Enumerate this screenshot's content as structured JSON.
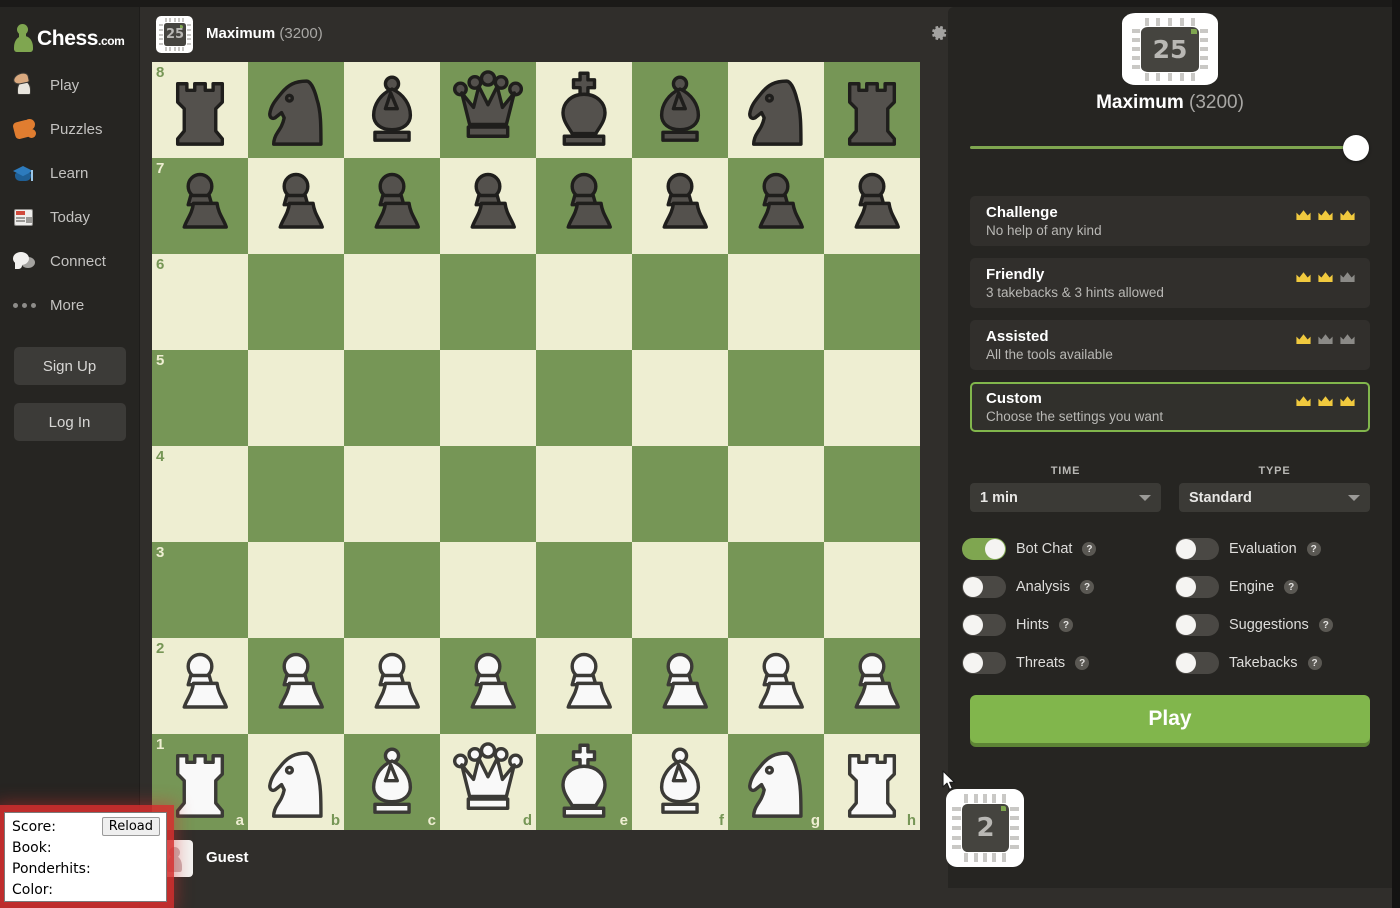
{
  "app": {
    "brand": "Chess",
    "brand_domain": ".com"
  },
  "sidebar": {
    "items": [
      {
        "label": "Play",
        "icon": "play-pawn-icon"
      },
      {
        "label": "Puzzles",
        "icon": "puzzle-piece-icon"
      },
      {
        "label": "Learn",
        "icon": "graduation-cap-icon"
      },
      {
        "label": "Today",
        "icon": "newspaper-icon"
      },
      {
        "label": "Connect",
        "icon": "speech-bubbles-icon"
      },
      {
        "label": "More",
        "icon": "ellipsis-icon"
      }
    ],
    "signup_label": "Sign Up",
    "login_label": "Log In"
  },
  "board_header": {
    "bot_name": "Maximum",
    "bot_rating": "(3200)",
    "avatar_chip_number": "25",
    "settings_icon": "gear-icon"
  },
  "board_footer": {
    "player_name": "Guest",
    "avatar": "pawn-avatar"
  },
  "board": {
    "ranks": [
      "8",
      "7",
      "6",
      "5",
      "4",
      "3",
      "2",
      "1"
    ],
    "files": [
      "a",
      "b",
      "c",
      "d",
      "e",
      "f",
      "g",
      "h"
    ],
    "light_color": "#eeeed2",
    "dark_color": "#769656",
    "position": [
      [
        "br",
        "bn",
        "bb",
        "bq",
        "bk",
        "bb",
        "bn",
        "br"
      ],
      [
        "bp",
        "bp",
        "bp",
        "bp",
        "bp",
        "bp",
        "bp",
        "bp"
      ],
      [
        "",
        "",
        "",
        "",
        "",
        "",
        "",
        ""
      ],
      [
        "",
        "",
        "",
        "",
        "",
        "",
        "",
        ""
      ],
      [
        "",
        "",
        "",
        "",
        "",
        "",
        "",
        ""
      ],
      [
        "",
        "",
        "",
        "",
        "",
        "",
        "",
        ""
      ],
      [
        "wp",
        "wp",
        "wp",
        "wp",
        "wp",
        "wp",
        "wp",
        "wp"
      ],
      [
        "wr",
        "wn",
        "wb",
        "wq",
        "wk",
        "wb",
        "wn",
        "wr"
      ]
    ]
  },
  "panel": {
    "bot_name": "Maximum",
    "bot_rating": "(3200)",
    "avatar_chip_number": "25",
    "strength_slider": {
      "value": 100,
      "accent": "#7fa650"
    },
    "modes": [
      {
        "title": "Challenge",
        "subtitle": "No help of any kind",
        "crowns_filled": 3,
        "selected": false
      },
      {
        "title": "Friendly",
        "subtitle": "3 takebacks & 3 hints allowed",
        "crowns_filled": 2,
        "selected": false
      },
      {
        "title": "Assisted",
        "subtitle": "All the tools available",
        "crowns_filled": 1,
        "selected": false
      },
      {
        "title": "Custom",
        "subtitle": "Choose the settings you want",
        "crowns_filled": 3,
        "selected": true
      }
    ],
    "crown_colors": {
      "filled": "#f0c93e",
      "empty": "#8b8a87"
    },
    "selects": [
      {
        "caption": "TIME",
        "value": "1 min"
      },
      {
        "caption": "TYPE",
        "value": "Standard"
      }
    ],
    "toggles": [
      {
        "label": "Bot Chat",
        "on": true,
        "help": "?"
      },
      {
        "label": "Evaluation",
        "on": false,
        "help": "?"
      },
      {
        "label": "Analysis",
        "on": false,
        "help": "?"
      },
      {
        "label": "Engine",
        "on": false,
        "help": "?"
      },
      {
        "label": "Hints",
        "on": false,
        "help": "?"
      },
      {
        "label": "Suggestions",
        "on": false,
        "help": "?"
      },
      {
        "label": "Threats",
        "on": false,
        "help": "?"
      },
      {
        "label": "Takebacks",
        "on": false,
        "help": "?"
      }
    ],
    "play_label": "Play",
    "bot_tile_number": "2",
    "accent_green": "#81b64c"
  },
  "engine_overlay": {
    "reload_label": "Reload",
    "lines": [
      "Score:",
      "Book:",
      "Ponderhits:",
      "Color:"
    ],
    "highlight_color": "#d62e2e"
  }
}
